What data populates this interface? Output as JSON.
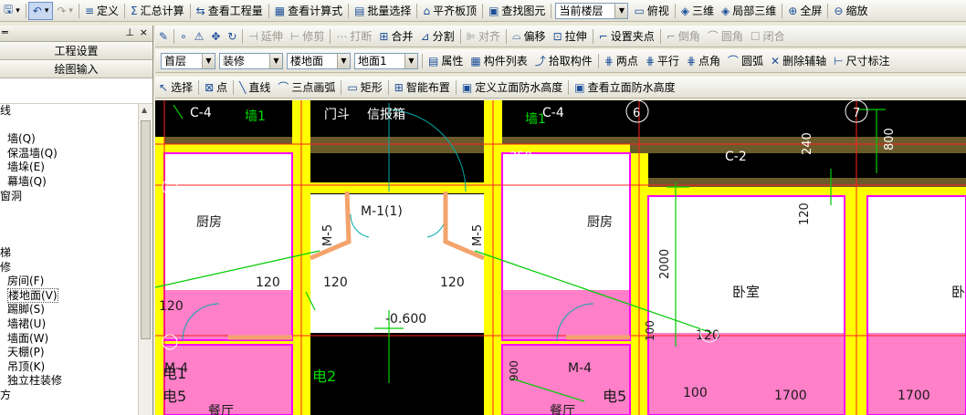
{
  "toolbar1": {
    "items": [
      {
        "name": "define",
        "icon": "≡",
        "label": "定义"
      },
      {
        "name": "sum-calc",
        "icon": "Σ",
        "label": "汇总计算"
      },
      {
        "name": "view-quantity",
        "icon": "⇆",
        "label": "查看工程量"
      },
      {
        "name": "view-formula",
        "icon": "▦",
        "label": "查看计算式"
      },
      {
        "name": "batch-select",
        "icon": "▤",
        "label": "批量选择"
      },
      {
        "name": "flat-slab",
        "icon": "⌂",
        "label": "平齐板顶"
      },
      {
        "name": "find-element",
        "icon": "▣",
        "label": "查找图元"
      }
    ],
    "floor_combo": "当前楼层",
    "view_items": [
      {
        "name": "top-view",
        "icon": "▭",
        "label": "俯视"
      },
      {
        "name": "3d-view",
        "icon": "◈",
        "label": "三维"
      },
      {
        "name": "partial-3d",
        "icon": "◈",
        "label": "局部三维"
      },
      {
        "name": "fullscreen",
        "icon": "⊕",
        "label": "全屏"
      },
      {
        "name": "zoom",
        "icon": "⊖",
        "label": "缩放"
      }
    ]
  },
  "toolbar2": {
    "items": [
      {
        "name": "extend",
        "icon": "⊣",
        "label": "延伸"
      },
      {
        "name": "trim",
        "icon": "⊢",
        "label": "修剪"
      },
      {
        "name": "break",
        "icon": "⋯",
        "label": "打断"
      },
      {
        "name": "merge",
        "icon": "⊞",
        "label": "合并"
      },
      {
        "name": "split",
        "icon": "⊿",
        "label": "分割"
      },
      {
        "name": "align",
        "icon": "⊫",
        "label": "对齐"
      },
      {
        "name": "offset",
        "icon": "⌓",
        "label": "偏移"
      },
      {
        "name": "stretch",
        "icon": "⊡",
        "label": "拉伸"
      },
      {
        "name": "set-grip",
        "icon": "⌐",
        "label": "设置夹点"
      },
      {
        "name": "chamfer",
        "icon": "⌐",
        "label": "倒角"
      },
      {
        "name": "fillet",
        "icon": "⌒",
        "label": "圆角"
      },
      {
        "name": "close",
        "icon": "☐",
        "label": "闭合"
      }
    ],
    "disabled": [
      "extend",
      "trim",
      "break",
      "align",
      "chamfer",
      "fillet",
      "close"
    ]
  },
  "toolbar3": {
    "floor": "首层",
    "category": "装修",
    "component_type": "楼地面",
    "component": "地面1",
    "items": [
      {
        "name": "properties",
        "icon": "▤",
        "label": "属性"
      },
      {
        "name": "component-list",
        "icon": "▦",
        "label": "构件列表"
      },
      {
        "name": "pick-component",
        "icon": "⤴",
        "label": "拾取构件"
      },
      {
        "name": "two-points",
        "icon": "⋕",
        "label": "两点"
      },
      {
        "name": "parallel",
        "icon": "⋕",
        "label": "平行"
      },
      {
        "name": "point-angle",
        "icon": "⋕",
        "label": "点角"
      },
      {
        "name": "arc",
        "icon": "⌒",
        "label": "圆弧"
      },
      {
        "name": "delete-aux",
        "icon": "✕",
        "label": "删除辅轴"
      },
      {
        "name": "dimension",
        "icon": "⊢",
        "label": "尺寸标注"
      }
    ]
  },
  "toolbar4": {
    "items": [
      {
        "name": "select",
        "icon": "↖",
        "label": "选择"
      },
      {
        "name": "point",
        "icon": "⊠",
        "label": "点"
      },
      {
        "name": "line",
        "icon": "╲",
        "label": "直线"
      },
      {
        "name": "three-point-arc",
        "icon": "⌒",
        "label": "三点画弧"
      },
      {
        "name": "rect",
        "icon": "▭",
        "label": "矩形"
      },
      {
        "name": "smart-layout",
        "icon": "⊞",
        "label": "智能布置"
      },
      {
        "name": "define-elev",
        "icon": "▣",
        "label": "定义立面防水高度"
      },
      {
        "name": "view-elev",
        "icon": "▣",
        "label": "查看立面防水高度"
      }
    ]
  },
  "leftpanel": {
    "buttons": [
      "工程设置",
      "绘图输入"
    ],
    "tree": [
      {
        "label": "线",
        "indent": 0
      },
      {
        "label": "",
        "indent": 0
      },
      {
        "label": "墙(Q)",
        "indent": 1
      },
      {
        "label": "保温墙(Q)",
        "indent": 1
      },
      {
        "label": "墙垛(E)",
        "indent": 1
      },
      {
        "label": "幕墙(Q)",
        "indent": 1
      },
      {
        "label": "窗洞",
        "indent": 0
      },
      {
        "label": "",
        "indent": 0
      },
      {
        "label": "",
        "indent": 0
      },
      {
        "label": "",
        "indent": 0
      },
      {
        "label": "梯",
        "indent": 0
      },
      {
        "label": "修",
        "indent": 0
      },
      {
        "label": "房间(F)",
        "indent": 1
      },
      {
        "label": "楼地面(V)",
        "indent": 1,
        "selected": true
      },
      {
        "label": "踢脚(S)",
        "indent": 1
      },
      {
        "label": "墙裙(U)",
        "indent": 1
      },
      {
        "label": "墙面(W)",
        "indent": 1
      },
      {
        "label": "天棚(P)",
        "indent": 1
      },
      {
        "label": "吊顶(K)",
        "indent": 1
      },
      {
        "label": "独立柱装修",
        "indent": 1
      },
      {
        "label": "方",
        "indent": 0
      }
    ]
  },
  "drawing": {
    "labels": [
      {
        "text": "C-4",
        "kind": "white"
      },
      {
        "text": "门斗",
        "kind": "white"
      },
      {
        "text": "信报箱",
        "kind": "white"
      },
      {
        "text": "C-4",
        "kind": "white"
      },
      {
        "text": "C-2",
        "kind": "white"
      },
      {
        "text": "240",
        "kind": "white"
      },
      {
        "text": "800",
        "kind": "white"
      },
      {
        "text": "350",
        "kind": "white"
      },
      {
        "text": "120",
        "kind": "white"
      },
      {
        "text": "厨房",
        "kind": "dark"
      },
      {
        "text": "M-1(1)",
        "kind": "dark"
      },
      {
        "text": "M-5",
        "kind": "dark"
      },
      {
        "text": "M-5",
        "kind": "dark"
      },
      {
        "text": "厨房",
        "kind": "dark"
      },
      {
        "text": "120",
        "kind": "dark"
      },
      {
        "text": "2000",
        "kind": "dark"
      },
      {
        "text": "120",
        "kind": "dark"
      },
      {
        "text": "120",
        "kind": "dark"
      },
      {
        "text": "120",
        "kind": "dark"
      },
      {
        "text": "卧室",
        "kind": "dark"
      },
      {
        "text": "卧",
        "kind": "dark"
      },
      {
        "text": "-0.600",
        "kind": "dark"
      },
      {
        "text": "120",
        "kind": "dark"
      },
      {
        "text": "120",
        "kind": "dark"
      },
      {
        "text": "100",
        "kind": "dark"
      },
      {
        "text": "M-4",
        "kind": "dark"
      },
      {
        "text": "M-4",
        "kind": "dark"
      },
      {
        "text": "900",
        "kind": "dark"
      },
      {
        "text": "100",
        "kind": "dark"
      },
      {
        "text": "1700",
        "kind": "dark"
      },
      {
        "text": "1700",
        "kind": "dark"
      },
      {
        "text": "电1",
        "kind": "dark"
      },
      {
        "text": "电5",
        "kind": "dark"
      },
      {
        "text": "电2",
        "kind": "green"
      },
      {
        "text": "电5",
        "kind": "dark"
      },
      {
        "text": "餐厅",
        "kind": "dark"
      },
      {
        "text": "餐厅",
        "kind": "dark"
      },
      {
        "text": "6",
        "kind": "axis"
      },
      {
        "text": "7",
        "kind": "axis"
      },
      {
        "text": "墙1",
        "kind": "green"
      },
      {
        "text": "墙1",
        "kind": "green"
      }
    ]
  },
  "colors": {
    "pink": "#ff7fc8",
    "yellow": "#ffff00",
    "wall_brown": "#6b5a2a",
    "green": "#00cc00"
  }
}
